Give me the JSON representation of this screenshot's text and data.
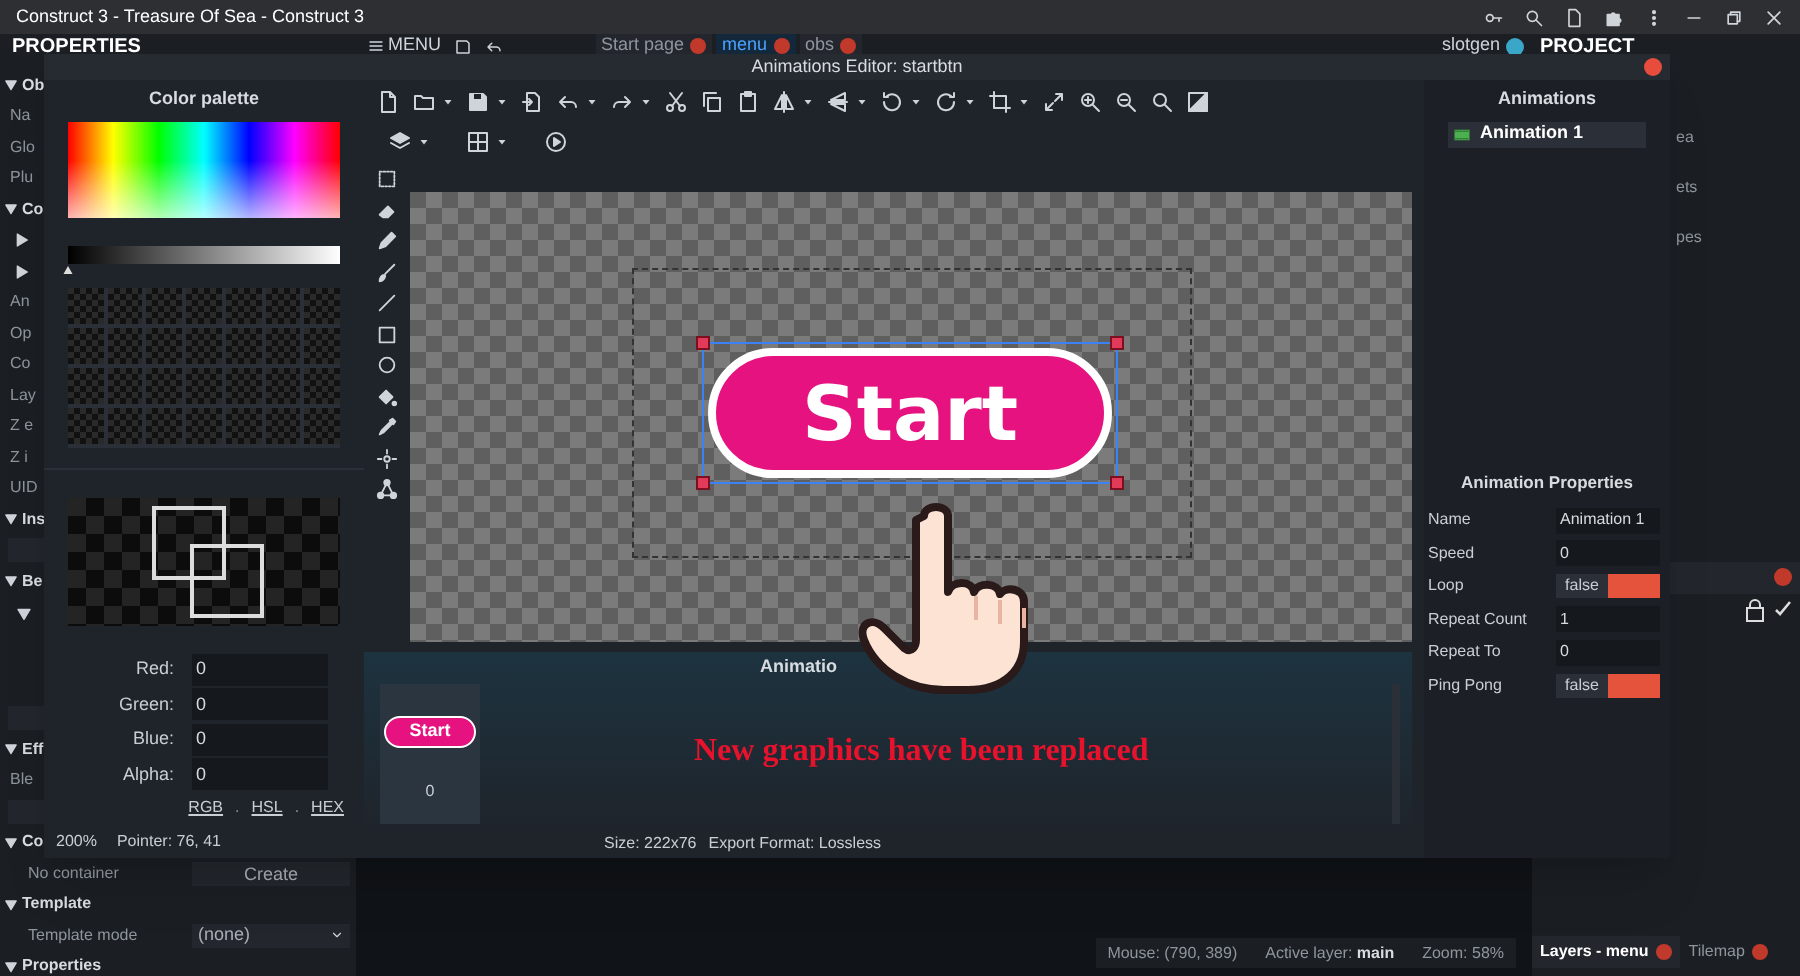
{
  "window": {
    "title": "Construct 3 - Treasure Of Sea - Construct 3"
  },
  "properties_panel": {
    "title": "PROPERTIES",
    "rows": [
      {
        "kind": "section",
        "label": "Ob"
      },
      {
        "kind": "item",
        "label": "Na"
      },
      {
        "kind": "item",
        "label": "Glo"
      },
      {
        "kind": "item",
        "label": "Plu"
      },
      {
        "kind": "section",
        "label": "Co"
      },
      {
        "kind": "sub"
      },
      {
        "kind": "sub"
      },
      {
        "kind": "item",
        "label": "An"
      },
      {
        "kind": "item",
        "label": "Op"
      },
      {
        "kind": "item",
        "label": "Co"
      },
      {
        "kind": "item",
        "label": "Lay"
      },
      {
        "kind": "item",
        "label": "Z e"
      },
      {
        "kind": "item",
        "label": "Z i"
      },
      {
        "kind": "item",
        "label": "UID"
      },
      {
        "kind": "section",
        "label": "Ins"
      },
      {
        "kind": "bar"
      },
      {
        "kind": "section",
        "label": "Be"
      },
      {
        "kind": "subsection"
      },
      {
        "kind": "bar"
      },
      {
        "kind": "section",
        "label": "Eff"
      },
      {
        "kind": "item",
        "label": "Ble"
      },
      {
        "kind": "bar"
      },
      {
        "kind": "section",
        "label": "Co"
      },
      {
        "kind": "button",
        "label": "No container",
        "value": "Create"
      },
      {
        "kind": "section",
        "label": "Template"
      },
      {
        "kind": "dropdown",
        "label": "Template mode",
        "value": "(none)"
      },
      {
        "kind": "section",
        "label": "Properties"
      }
    ]
  },
  "main_toolbar": {
    "menu": "MENU",
    "tabs": [
      {
        "label": "Start page",
        "selected": false
      },
      {
        "label": "menu",
        "selected": true
      },
      {
        "label": "obs",
        "selected": false
      }
    ],
    "user": "slotgen"
  },
  "status_bar": {
    "mouse": "Mouse: (790, 389)",
    "active_layer_label": "Active layer:",
    "active_layer": "main",
    "zoom": "Zoom: 58%"
  },
  "project_panel": {
    "title": "PROJECT",
    "items": [
      "ea",
      "ets",
      "pes"
    ]
  },
  "layers_panel": {
    "tabs": [
      {
        "label": "Layers - menu",
        "selected": true
      },
      {
        "label": "Tilemap",
        "selected": false
      }
    ]
  },
  "dialog": {
    "title": "Animations Editor: startbtn",
    "color_palette": {
      "title": "Color palette",
      "fields": [
        {
          "label": "Red:",
          "value": "0"
        },
        {
          "label": "Green:",
          "value": "0"
        },
        {
          "label": "Blue:",
          "value": "0"
        },
        {
          "label": "Alpha:",
          "value": "0"
        }
      ],
      "brightness": {
        "level": 0
      },
      "modes": [
        "RGB",
        "HSL",
        "HEX"
      ],
      "separator": "."
    },
    "canvas": {
      "sprite_text": "Start"
    },
    "frames": {
      "title": "Animatio",
      "items": [
        {
          "text": "Start",
          "index": "0",
          "selected": true
        }
      ]
    },
    "animations": {
      "title": "Animations",
      "items": [
        {
          "label": "Animation 1",
          "selected": true
        }
      ]
    },
    "properties": {
      "title": "Animation Properties",
      "rows": [
        {
          "kind": "text",
          "label": "Name",
          "value": "Animation 1"
        },
        {
          "kind": "text",
          "label": "Speed",
          "value": "0"
        },
        {
          "kind": "toggle",
          "label": "Loop",
          "value": "false",
          "on": false
        },
        {
          "kind": "text",
          "label": "Repeat Count",
          "value": "1"
        },
        {
          "kind": "text",
          "label": "Repeat To",
          "value": "0"
        },
        {
          "kind": "toggle",
          "label": "Ping Pong",
          "value": "false",
          "on": false
        }
      ]
    },
    "status": {
      "zoom": "200%",
      "pointer": "Pointer: 76, 41",
      "size": "Size: 222x76",
      "export_format": "Export Format: Lossless"
    }
  },
  "annotation": {
    "text": "New graphics have been replaced"
  }
}
